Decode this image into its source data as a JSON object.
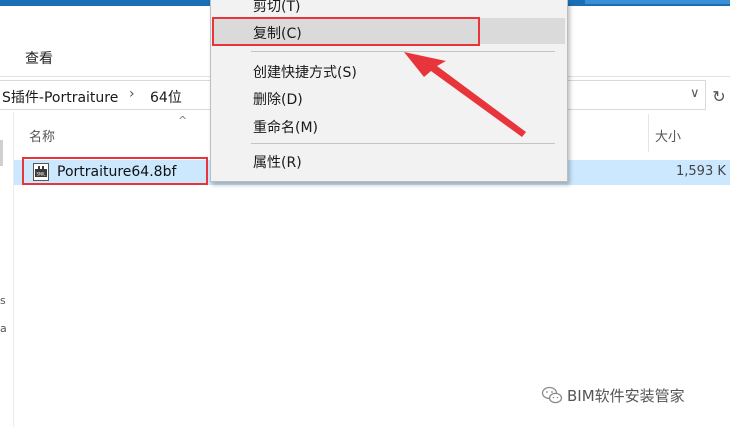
{
  "ribbon": {
    "view_tab": "查看"
  },
  "address": {
    "segments": [
      "S插件-Portraiture",
      "64位"
    ],
    "separator": "›",
    "dropdown_glyph": "∨",
    "refresh_glyph": "↻"
  },
  "gutter": {
    "text1": "s",
    "text2": "a"
  },
  "columns": {
    "name": "名称",
    "size": "大小",
    "sort_glyph": "^"
  },
  "file": {
    "name": "Portraiture64.8bf",
    "size": "1,593 K",
    "icon": "plugin-file-icon",
    "icon_label": "SNIL"
  },
  "context_menu": {
    "items": [
      {
        "label": "剪切(T)"
      },
      {
        "label": "复制(C)",
        "highlighted": true
      },
      {
        "label": "创建快捷方式(S)"
      },
      {
        "label": "删除(D)"
      },
      {
        "label": "重命名(M)"
      },
      {
        "label": "属性(R)"
      }
    ]
  },
  "annotation_color": "#e8353b",
  "selection_color": "#cce8ff",
  "watermark": {
    "text": "BIM软件安装管家",
    "icon": "wechat-icon"
  }
}
